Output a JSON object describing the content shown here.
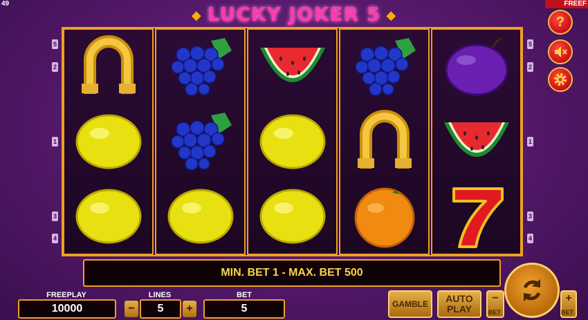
{
  "corner": {
    "left": "49",
    "right": "FREEF"
  },
  "title": "LUCKY JOKER 5",
  "reels": [
    [
      "horseshoe",
      "lemon",
      "lemon"
    ],
    [
      "grapes",
      "grapes",
      "lemon"
    ],
    [
      "watermelon",
      "lemon",
      "lemon"
    ],
    [
      "grapes",
      "horseshoe",
      "orange"
    ],
    [
      "plum",
      "watermelon",
      "seven"
    ]
  ],
  "line_markers": {
    "left": [
      {
        "label": "5"
      },
      {
        "label": "2"
      },
      {
        "label": "1"
      },
      {
        "label": "3"
      },
      {
        "label": "4"
      }
    ],
    "right": [
      {
        "label": "5"
      },
      {
        "label": "2"
      },
      {
        "label": "1"
      },
      {
        "label": "3"
      },
      {
        "label": "4"
      }
    ]
  },
  "side_buttons": {
    "help": "?",
    "sound": "sound-muted",
    "settings": "settings"
  },
  "bet_banner": "MIN. BET 1 - MAX. BET 500",
  "freeplay": {
    "label": "FREEPLAY",
    "value": "10000"
  },
  "lines": {
    "label": "LINES",
    "value": "5",
    "minus": "−",
    "plus": "+"
  },
  "bet": {
    "label": "BET",
    "value": "5"
  },
  "buttons": {
    "gamble": "GAMBLE",
    "autoplay_1": "AUTO",
    "autoplay_2": "PLAY",
    "bet_minus": "−",
    "bet_minus_label": "BET",
    "bet_plus": "+",
    "bet_plus_label": "BET"
  },
  "colors": {
    "frame": "#f0a020",
    "banner_text": "#ffd34a",
    "title": "#ff3ab0"
  }
}
